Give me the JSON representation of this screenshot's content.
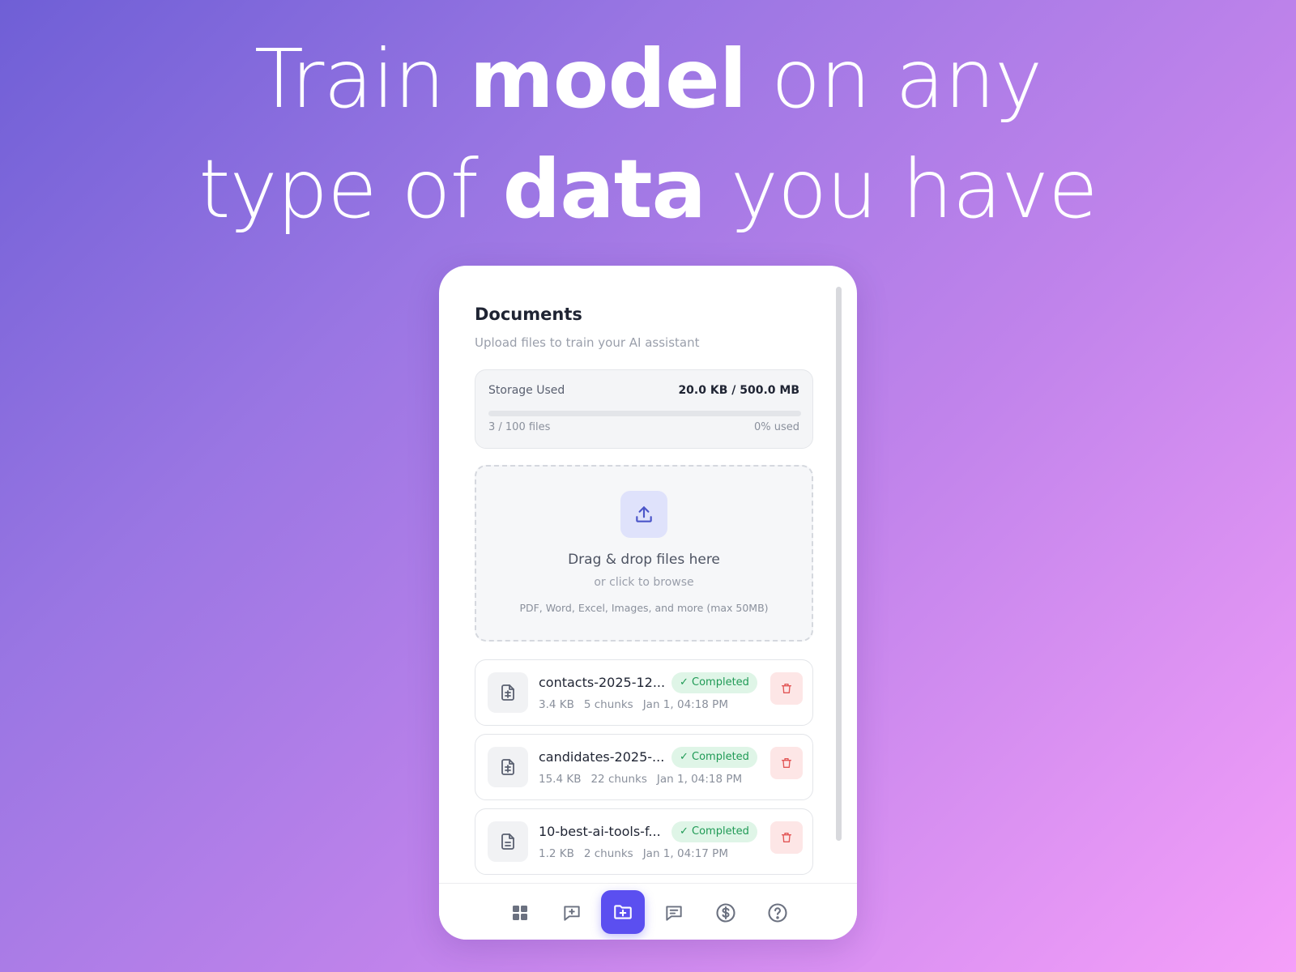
{
  "headline": {
    "line1_pre": "Train ",
    "line1_bold": "model",
    "line1_post": " on any",
    "line2_pre": "type of ",
    "line2_bold": "data",
    "line2_post": " you have"
  },
  "documents": {
    "title": "Documents",
    "subtitle": "Upload files to train your AI assistant"
  },
  "storage": {
    "label": "Storage Used",
    "amount": "20.0 KB / 500.0 MB",
    "files": "3 / 100 files",
    "used": "0% used",
    "used_fraction": 0
  },
  "dropzone": {
    "title": "Drag & drop files here",
    "subtitle": "or click to browse",
    "formats": "PDF, Word, Excel, Images, and more (max 50MB)",
    "icon": "upload-icon"
  },
  "files": [
    {
      "name": "contacts-2025-12...",
      "size": "3.4 KB",
      "chunks": "5 chunks",
      "date": "Jan 1, 04:18 PM",
      "status": "✓ Completed",
      "icon": "spreadsheet-file-icon"
    },
    {
      "name": "candidates-2025-...",
      "size": "15.4 KB",
      "chunks": "22 chunks",
      "date": "Jan 1, 04:18 PM",
      "status": "✓ Completed",
      "icon": "spreadsheet-file-icon"
    },
    {
      "name": "10-best-ai-tools-f...",
      "size": "1.2 KB",
      "chunks": "2 chunks",
      "date": "Jan 1, 04:17 PM",
      "status": "✓ Completed",
      "icon": "text-file-icon"
    }
  ],
  "nav": [
    {
      "icon": "grid-icon",
      "active": false
    },
    {
      "icon": "message-plus-icon",
      "active": false
    },
    {
      "icon": "folder-plus-icon",
      "active": true
    },
    {
      "icon": "chat-lines-icon",
      "active": false
    },
    {
      "icon": "dollar-circle-icon",
      "active": false
    },
    {
      "icon": "help-circle-icon",
      "active": false
    }
  ],
  "colors": {
    "accent": "#5b4ff0",
    "success_bg": "#dff5e7",
    "success_text": "#1f9a55",
    "danger_bg": "#fde6e6",
    "danger": "#e25555"
  }
}
